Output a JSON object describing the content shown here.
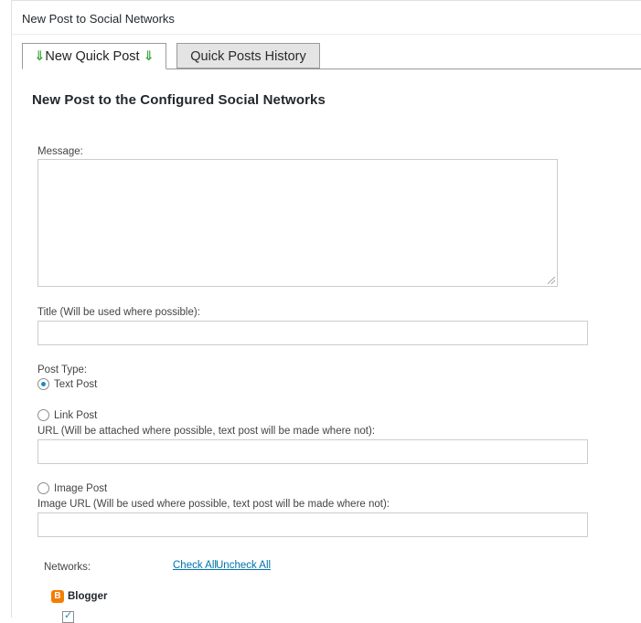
{
  "panel": {
    "title": "New Post to Social Networks"
  },
  "tabs": [
    {
      "label": "New Quick Post",
      "active": true,
      "arrow": "⇓"
    },
    {
      "label": "Quick Posts History",
      "active": false
    }
  ],
  "form": {
    "section_title": "New Post to the Configured Social Networks",
    "message_label": "Message:",
    "message_value": "",
    "title_label": "Title (Will be used where possible):",
    "title_value": "",
    "post_type_label": "Post Type:",
    "post_types": [
      {
        "label": "Text Post",
        "checked": true
      },
      {
        "label": "Link Post",
        "checked": false
      },
      {
        "label": "Image Post",
        "checked": false
      }
    ],
    "url_label": "URL (Will be attached where possible, text post will be made where not):",
    "url_value": "",
    "image_url_label": "Image URL (Will be used where possible, text post will be made where not):",
    "image_url_value": ""
  },
  "networks": {
    "label": "Networks:",
    "check_all": "Check All",
    "uncheck_all": "Uncheck All",
    "items": [
      {
        "name": "Blogger",
        "icon": "blogger-icon",
        "color": "#f57d00",
        "checked": true
      }
    ]
  },
  "colors": {
    "accent": "#0073aa",
    "arrow": "#3aa63a",
    "radio": "#1e8cbe"
  }
}
